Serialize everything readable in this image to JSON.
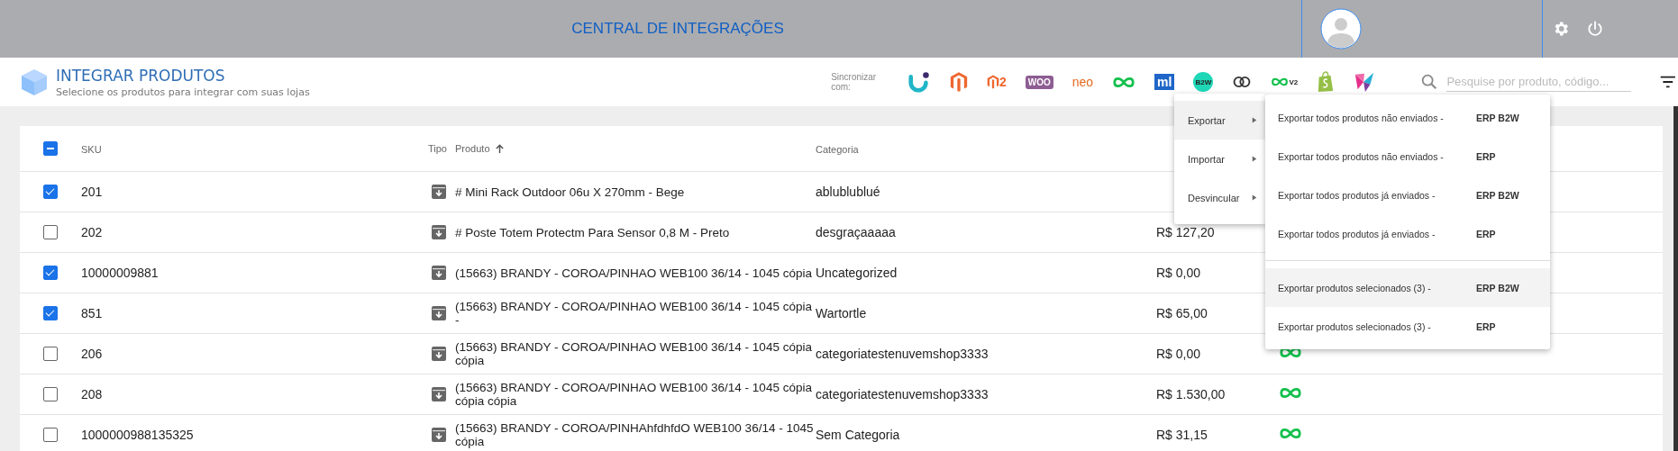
{
  "header": {
    "title": "CENTRAL DE INTEGRAÇÕES"
  },
  "page": {
    "title": "INTEGRAR PRODUTOS",
    "subtitle": "Selecione os produtos para integrar com suas lojas"
  },
  "sync": {
    "label": "Sincronizar com:",
    "integrations": [
      {
        "kind": "u"
      },
      {
        "kind": "magento"
      },
      {
        "kind": "magento2",
        "text": "2"
      },
      {
        "kind": "woo",
        "text": "WOO"
      },
      {
        "kind": "neo",
        "text": "neo"
      },
      {
        "kind": "infinity"
      },
      {
        "kind": "ml",
        "text": "ml"
      },
      {
        "kind": "b2w",
        "text": "B2W"
      },
      {
        "kind": "rings"
      },
      {
        "kind": "infinity2",
        "text": "V2"
      },
      {
        "kind": "shopify"
      },
      {
        "kind": "tray"
      }
    ]
  },
  "search": {
    "placeholder": "Pesquise por produto, código..."
  },
  "table": {
    "select_all": {
      "indeterminate": true
    },
    "columns": {
      "sku": "SKU",
      "tipo": "Tipo",
      "produto": "Produto",
      "categoria": "Categoria"
    },
    "rows": [
      {
        "checked": true,
        "sku": "201",
        "produto": "# Mini Rack Outdoor 06u X 270mm - Bege",
        "categoria": "ablublublué"
      },
      {
        "checked": false,
        "sku": "202",
        "produto": "# Poste Totem Protectm Para Sensor 0,8 M - Preto",
        "categoria": "desgraçaaaaa",
        "preco": "R$ 127,20"
      },
      {
        "checked": true,
        "sku": "10000009881",
        "produto": "(15663) BRANDY - COROA/PINHAO WEB100 36/14 - 1045 cópia",
        "categoria": "Uncategorized",
        "preco": "R$ 0,00"
      },
      {
        "checked": true,
        "sku": "851",
        "produto": "(15663) BRANDY - COROA/PINHAO WEB100 36/14 - 1045 cópia -",
        "categoria": "Wartortle",
        "preco": "R$ 65,00"
      },
      {
        "checked": false,
        "sku": "206",
        "produto": "(15663) BRANDY - COROA/PINHAO WEB100 36/14 - 1045 cópia cópia",
        "categoria": "categoriatestenuvemshop3333",
        "preco": "R$ 0,00",
        "synced": true
      },
      {
        "checked": false,
        "sku": "208",
        "produto": "(15663) BRANDY - COROA/PINHAO WEB100 36/14 - 1045 cópia cópia cópia",
        "categoria": "categoriatestenuvemshop3333",
        "preco": "R$ 1.530,00",
        "synced": true
      },
      {
        "checked": false,
        "sku": "1000000988135325",
        "produto": "(15663) BRANDY - COROA/PINHAhfdhfdO WEB100 36/14 - 1045 cópia",
        "categoria": "Sem Categoria",
        "preco": "R$ 31,15",
        "synced": true
      }
    ]
  },
  "menu": {
    "items": [
      {
        "label": "Exportar",
        "selected": true
      },
      {
        "label": "Importar",
        "selected": false
      },
      {
        "label": "Desvincular",
        "selected": false
      }
    ]
  },
  "submenu": {
    "groups": [
      {
        "items": [
          {
            "label": "Exportar todos produtos não enviados -",
            "target": "ERP B2W",
            "selected": false
          },
          {
            "label": "Exportar todos produtos não enviados -",
            "target": "ERP",
            "selected": false
          },
          {
            "label": "Exportar todos produtos já enviados -",
            "target": "ERP B2W",
            "selected": false
          },
          {
            "label": "Exportar todos produtos já enviados -",
            "target": "ERP",
            "selected": false
          }
        ]
      },
      {
        "items": [
          {
            "label": "Exportar produtos selecionados (3) -",
            "target": "ERP B2W",
            "selected": true
          },
          {
            "label": "Exportar produtos selecionados (3) -",
            "target": "ERP",
            "selected": false
          }
        ]
      }
    ]
  }
}
